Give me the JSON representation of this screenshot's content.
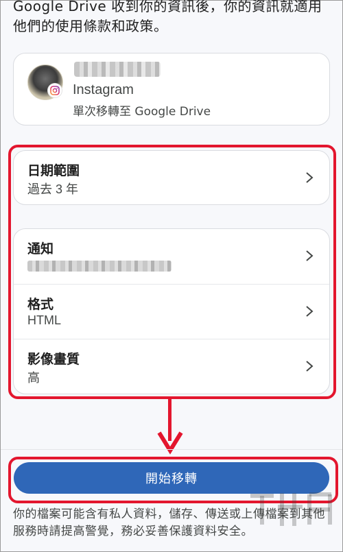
{
  "intro": {
    "text": "Google Drive 收到你的資訊後，你的資訊就適用他們的使用條款和政策。"
  },
  "source": {
    "service": "Instagram",
    "subtitle": "單次移轉至 Google Drive",
    "badge_icon": "instagram-icon"
  },
  "settings": {
    "date_range": {
      "label": "日期範圍",
      "value": "過去 3 年"
    },
    "notification": {
      "label": "通知"
    },
    "format": {
      "label": "格式",
      "value": "HTML"
    },
    "quality": {
      "label": "影像畫質",
      "value": "高"
    }
  },
  "action": {
    "start_label": "開始移轉"
  },
  "footer": {
    "disclaimer": "你的檔案可能含有私人資料，儲存、傳送或上傳檔案到其他服務時請提高警覺，務必妥善保護資料安全。"
  },
  "colors": {
    "accent": "#2f67b8",
    "highlight": "#e3162e"
  }
}
